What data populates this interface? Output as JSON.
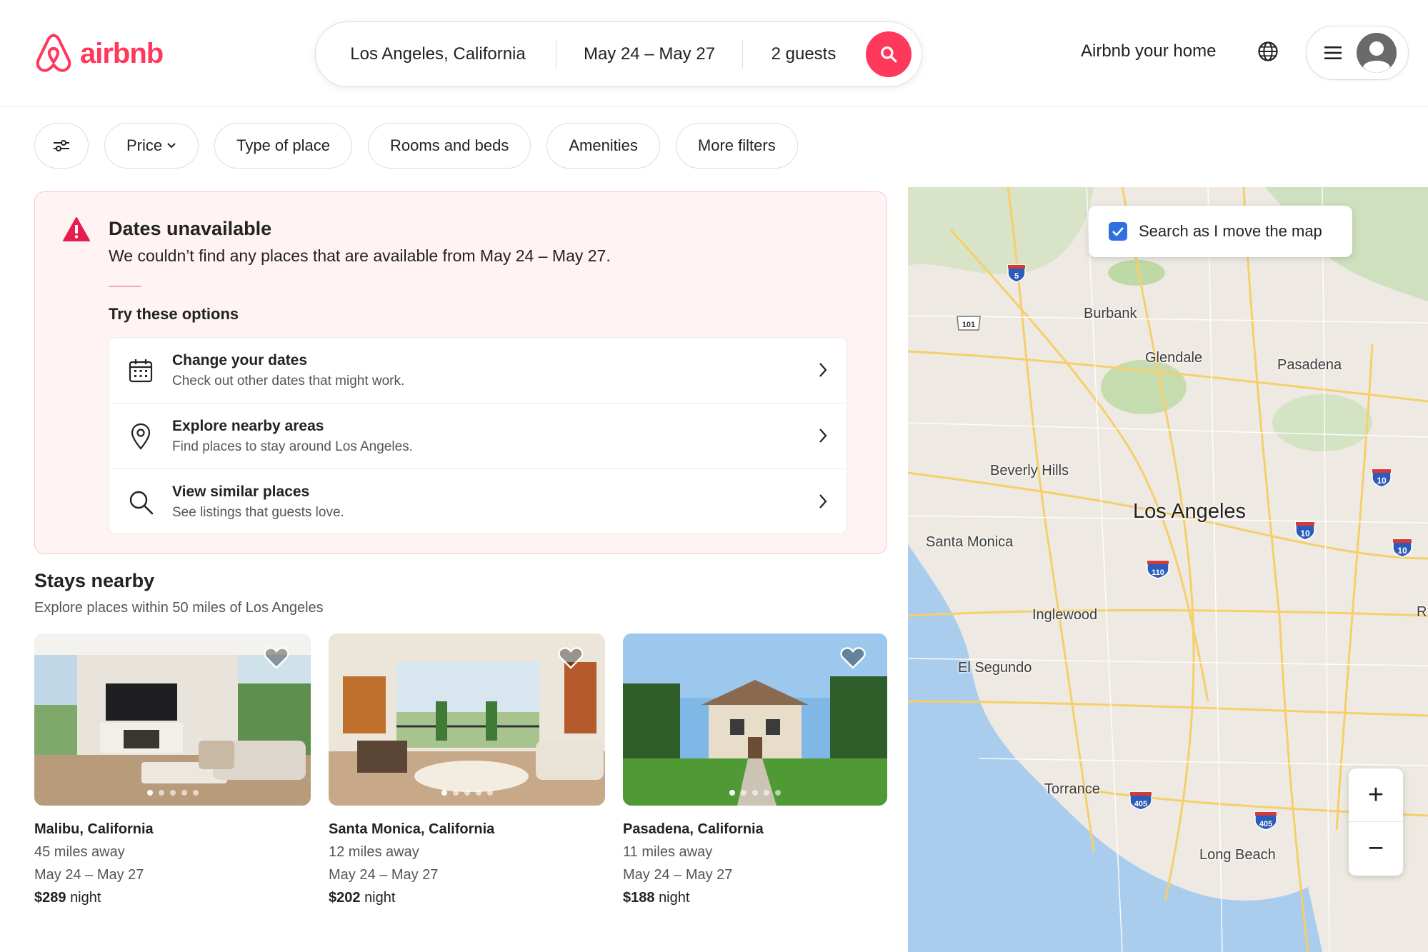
{
  "header": {
    "logo_text": "airbnb",
    "search": {
      "location": "Los Angeles, California",
      "dates": "May 24 – May 27",
      "guests": "2 guests"
    },
    "host_link": "Airbnb your home"
  },
  "filters": {
    "items": [
      "Price",
      "Type of place",
      "Rooms and beds",
      "Amenities",
      "More filters"
    ]
  },
  "alert": {
    "title": "Dates unavailable",
    "description": "We couldn’t find any places that are available from May 24 – May 27.",
    "try_title": "Try these options",
    "options": [
      {
        "title": "Change your dates",
        "subtitle": "Check out other dates that might work.",
        "icon": "calendar-icon"
      },
      {
        "title": "Explore nearby areas",
        "subtitle": "Find places to stay around Los Angeles.",
        "icon": "location-pin-icon"
      },
      {
        "title": "View similar places",
        "subtitle": "See listings that guests love.",
        "icon": "search-icon"
      }
    ]
  },
  "stays": {
    "title": "Stays nearby",
    "subtitle": "Explore places within 50 miles of Los Angeles",
    "cards": [
      {
        "title": "Malibu, California",
        "distance": "45 miles away",
        "dates": "May 24 – May 27",
        "price": "$289",
        "price_unit": "night"
      },
      {
        "title": "Santa Monica, California",
        "distance": "12 miles away",
        "dates": "May 24 – May 27",
        "price": "$202",
        "price_unit": "night"
      },
      {
        "title": "Pasadena, California",
        "distance": "11 miles away",
        "dates": "May 24 – May 27",
        "price": "$188",
        "price_unit": "night"
      }
    ]
  },
  "map": {
    "toggle_label": "Search as I move the map",
    "labels": [
      "Burbank",
      "Glendale",
      "Pasadena",
      "Beverly Hills",
      "Los Angeles",
      "Santa Monica",
      "Inglewood",
      "El Segundo",
      "Torrance",
      "Long Beach",
      "R"
    ],
    "highway_shields": [
      "5",
      "101",
      "10",
      "10",
      "10",
      "110",
      "405",
      "405"
    ],
    "zoom_in": "+",
    "zoom_out": "−"
  },
  "colors": {
    "brand": "#ff385c",
    "alert_bg": "#fff3f4",
    "map_land": "#eeeae3",
    "map_water": "#aacdee",
    "map_road": "#f6cf6a",
    "checkbox": "#2f6fdf"
  }
}
